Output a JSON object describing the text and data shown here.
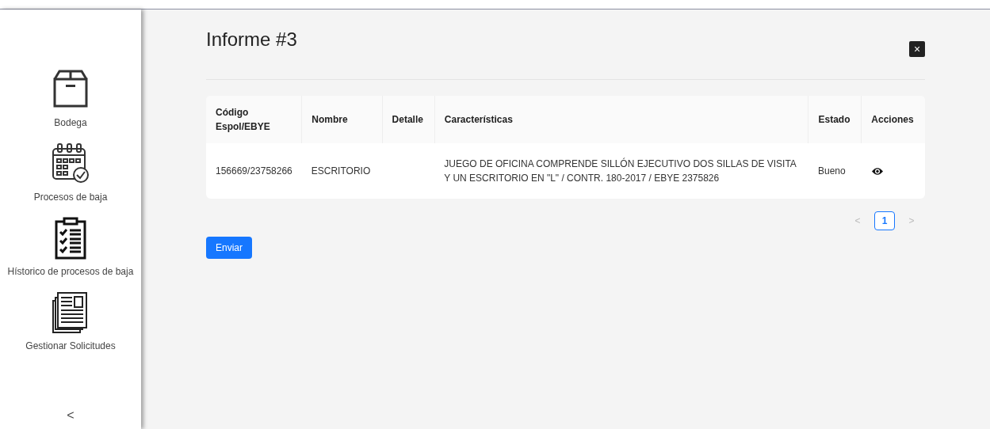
{
  "sidebar": {
    "items": [
      {
        "label": "Bodega"
      },
      {
        "label": "Procesos de baja"
      },
      {
        "label": "Hístorico de procesos de baja"
      },
      {
        "label": "Gestionar Solicitudes"
      }
    ],
    "collapse": "<"
  },
  "modal": {
    "title": "Informe #3",
    "close": "×",
    "table": {
      "columns": [
        "Código Espol/EBYE",
        "Nombre",
        "Detalle",
        "Características",
        "Estado",
        "Acciones"
      ],
      "rows": [
        {
          "cells": [
            "156669/23758266",
            "ESCRITORIO",
            "",
            "JUEGO DE OFICINA COMPRENDE SILLÓN EJECUTIVO DOS SILLAS DE VISITA Y UN ESCRITORIO EN \"L\" / CONTR. 180-2017 / EBYE 2375826",
            "Bueno"
          ]
        }
      ]
    },
    "pagination": {
      "prev": {
        "label": "<",
        "disabled": true
      },
      "pages": [
        {
          "label": "1",
          "selected": true
        }
      ],
      "next": {
        "label": ">",
        "disabled": true
      }
    },
    "submit": "Enviar"
  }
}
